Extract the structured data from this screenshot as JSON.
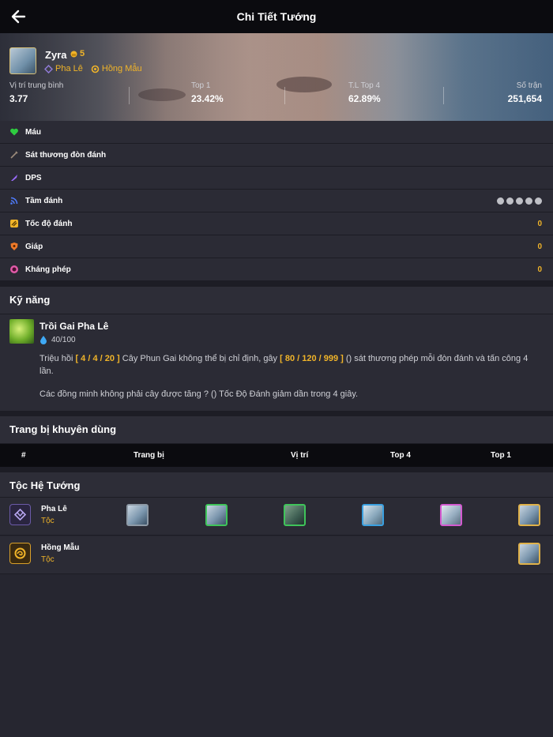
{
  "header": {
    "title": "Chi Tiết Tướng",
    "back_icon": "arrow-left-icon"
  },
  "champion": {
    "name": "Zyra",
    "cost": "5",
    "traits": [
      "Pha Lê",
      "Hồng Mẫu"
    ],
    "stats": [
      {
        "label": "Vị trí trung bình",
        "value": "3.77"
      },
      {
        "label": "Top 1",
        "value": "23.42%"
      },
      {
        "label": "T.L Top 4",
        "value": "62.89%"
      },
      {
        "label": "Số trận",
        "value": "251,654"
      }
    ]
  },
  "attributes": [
    {
      "label": "Máu",
      "value": "",
      "icon": "heart-icon",
      "color": "#2ecc40"
    },
    {
      "label": "Sát thương đòn đánh",
      "value": "",
      "icon": "sword-icon",
      "color": "#9a8a7a"
    },
    {
      "label": "DPS",
      "value": "",
      "icon": "dps-icon",
      "color": "#9b6cff"
    },
    {
      "label": "Tầm đánh",
      "value": "",
      "icon": "range-icon",
      "color": "#4f7cff"
    },
    {
      "label": "Tốc độ đánh",
      "value": "0",
      "icon": "attack-speed-icon",
      "color": "#f0b429"
    },
    {
      "label": "Giáp",
      "value": "0",
      "icon": "armor-icon",
      "color": "#f07a29"
    },
    {
      "label": "Kháng phép",
      "value": "0",
      "icon": "magic-resist-icon",
      "color": "#e05aa8"
    }
  ],
  "skills": {
    "heading": "Kỹ năng",
    "name": "Trồi Gai Pha Lê",
    "mana": "40/100",
    "desc_part1": "Triệu hồi ",
    "desc_hl1": "[ 4 / 4 / 20 ]",
    "desc_part2": " Cây Phun Gai không thể bị chỉ định, gây ",
    "desc_hl2": "[ 80 / 120 / 999 ]",
    "desc_part3": " () sát thương phép mỗi đòn đánh và tấn công 4 lần.",
    "desc_line2": "Các đồng minh không phải cây được tăng ? () Tốc Độ Đánh giảm dần trong 4 giây."
  },
  "items": {
    "heading": "Trang bị khuyên dùng",
    "columns": [
      "#",
      "Trang bị",
      "Vị trí",
      "Top 4",
      "Top 1"
    ]
  },
  "synergies": {
    "heading": "Tộc Hệ Tướng",
    "rows": [
      {
        "name": "Pha Lê",
        "type": "Tộc",
        "icon": "crystal-trait-icon"
      },
      {
        "name": "Hồng Mẫu",
        "type": "Tộc",
        "icon": "rose-trait-icon"
      }
    ]
  },
  "colors": {
    "accent": "#f0b429",
    "background": "#262630",
    "row": "#2b2b35",
    "header": "#0b0b0f"
  }
}
